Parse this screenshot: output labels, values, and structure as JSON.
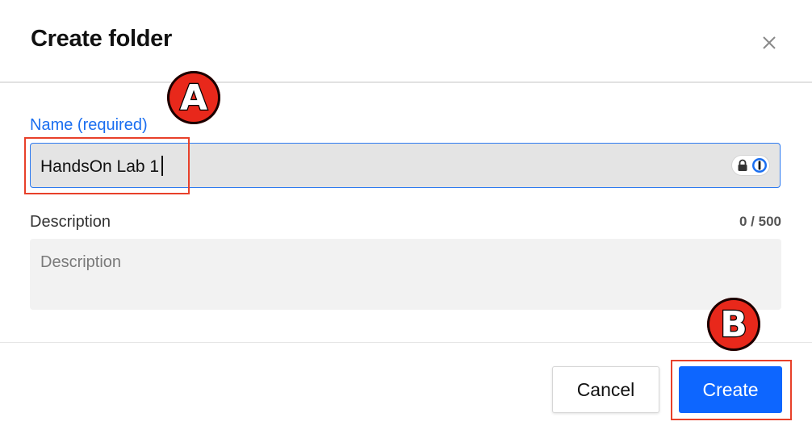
{
  "dialog": {
    "title": "Create folder",
    "close_icon": "close-icon"
  },
  "name_field": {
    "label": "Name (required)",
    "value": "HandsOn Lab 1",
    "password_manager_icons": [
      "lock-icon",
      "password-manager-key-icon"
    ]
  },
  "description_field": {
    "label": "Description",
    "counter": "0 / 500",
    "placeholder": "Description",
    "value": ""
  },
  "footer": {
    "cancel_label": "Cancel",
    "create_label": "Create"
  },
  "annotations": {
    "a": "A",
    "b": "B"
  },
  "colors": {
    "accent": "#0d66ff",
    "label_active": "#1a6ef0",
    "annotation_red": "#e8281b"
  }
}
